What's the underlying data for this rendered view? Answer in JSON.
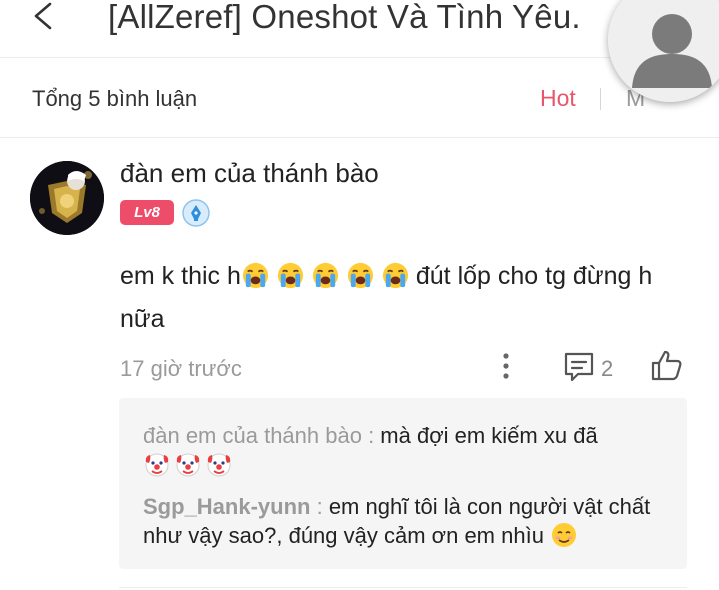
{
  "header": {
    "title": "[AllZeref] Oneshot Và Tình Yêu.",
    "back_icon": "chevron-left-icon"
  },
  "comments_bar": {
    "total_label": "Tổng 5 bình luận",
    "sort_hot": "Hot",
    "sort_new": "M",
    "hot_color": "#e9566b"
  },
  "comment": {
    "username": "đàn em của thánh bào",
    "level_badge": "Lv8",
    "badge_color": "#ee4d6a",
    "text_before": "em k thic h",
    "emoji_name": "loudly-crying-face",
    "text_after": "đút lốp cho tg đừng h nữa",
    "time": "17 giờ trước",
    "reply_count": "2"
  },
  "replies": [
    {
      "author": "đàn em của thánh bào",
      "separator": " : ",
      "text": "mà đợi em kiếm xu đã",
      "emoji_name": "clown-face"
    },
    {
      "author": "Sgp_Hank-yunn",
      "separator": " : ",
      "text": "em nghĩ tôi là con người vật chất như vậy sao?, đúng vậy cảm ơn em nhìu",
      "emoji_name": "smiling-face"
    }
  ]
}
